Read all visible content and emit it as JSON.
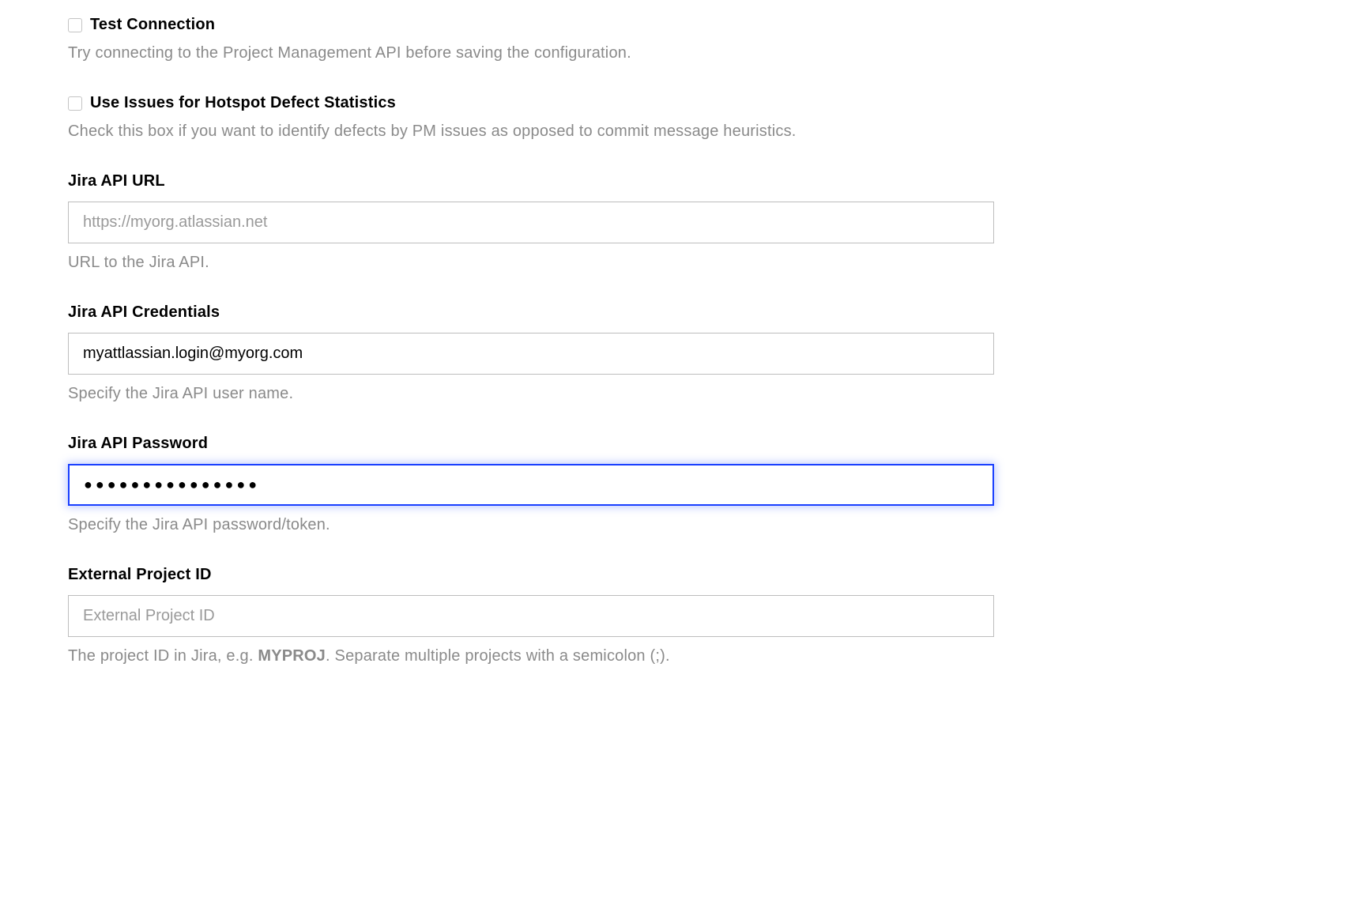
{
  "testConnection": {
    "label": "Test Connection",
    "help": "Try connecting to the Project Management API before saving the configuration."
  },
  "useIssues": {
    "label": "Use Issues for Hotspot Defect Statistics",
    "help": "Check this box if you want to identify defects by PM issues as opposed to commit message heuristics."
  },
  "jiraApiUrl": {
    "label": "Jira API URL",
    "placeholder": "https://myorg.atlassian.net",
    "value": "",
    "help": "URL to the Jira API."
  },
  "jiraApiCredentials": {
    "label": "Jira API Credentials",
    "value": "myattlassian.login@myorg.com",
    "help": "Specify the Jira API user name."
  },
  "jiraApiPassword": {
    "label": "Jira API Password",
    "value": "●●●●●●●●●●●●●●●",
    "help": "Specify the Jira API password/token."
  },
  "externalProjectId": {
    "label": "External Project ID",
    "placeholder": "External Project ID",
    "value": "",
    "helpPrefix": "The project ID in Jira, e.g. ",
    "helpBold": "MYPROJ",
    "helpSuffix": ". Separate multiple projects with a semicolon (;)."
  }
}
